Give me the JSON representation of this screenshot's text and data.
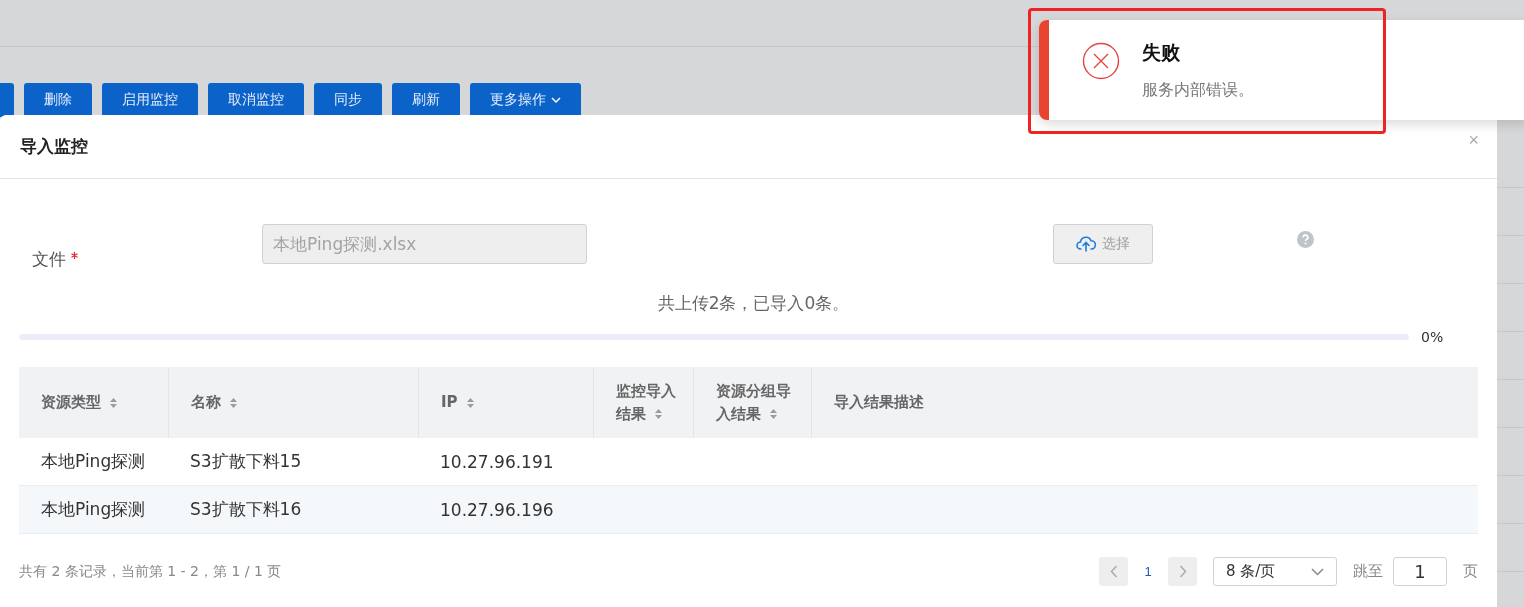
{
  "toolbar": {
    "buttons": [
      {
        "kind": "cut"
      },
      {
        "label": "删除"
      },
      {
        "label": "启用监控"
      },
      {
        "label": "取消监控"
      },
      {
        "label": "同步"
      },
      {
        "label": "刷新"
      },
      {
        "label": "更多操作",
        "kind": "dropdown"
      }
    ]
  },
  "dialog": {
    "title": "导入监控",
    "close": "×",
    "file_field": {
      "label": "文件",
      "required": true,
      "value": "本地Ping探测.xlsx",
      "disabled": true
    },
    "select_button": {
      "label": "选择"
    },
    "summary": "共上传2条，已导入0条。",
    "progress": {
      "level": 0,
      "reading": "0%"
    },
    "table": {
      "columns": [
        {
          "label": "资源类型",
          "sortable": true
        },
        {
          "label": "名称",
          "sortable": true
        },
        {
          "label": "IP",
          "sortable": true
        },
        {
          "label": "监控导入结果",
          "sortable": true
        },
        {
          "label": "资源分组导入结果",
          "sortable": true
        },
        {
          "label": "导入结果描述",
          "sortable": false
        }
      ],
      "rows": [
        {
          "cells": [
            "本地Ping探测",
            "S3扩散下料15",
            "10.27.96.191",
            "",
            "",
            ""
          ]
        },
        {
          "cells": [
            "本地Ping探测",
            "S3扩散下料16",
            "10.27.96.196",
            "",
            "",
            ""
          ]
        }
      ]
    },
    "pagination": {
      "summary": "共有 2 条记录，当前第 1 - 2，第 1 / 1 页",
      "pages": [
        {
          "label": "1",
          "selected": true
        }
      ],
      "page_size": "8 条/页",
      "jump_label": "跳至",
      "jump_value": "1",
      "page_unit": "页"
    }
  },
  "toast": {
    "title": "失败",
    "message": "服务内部错误。",
    "highlighted": true
  }
}
